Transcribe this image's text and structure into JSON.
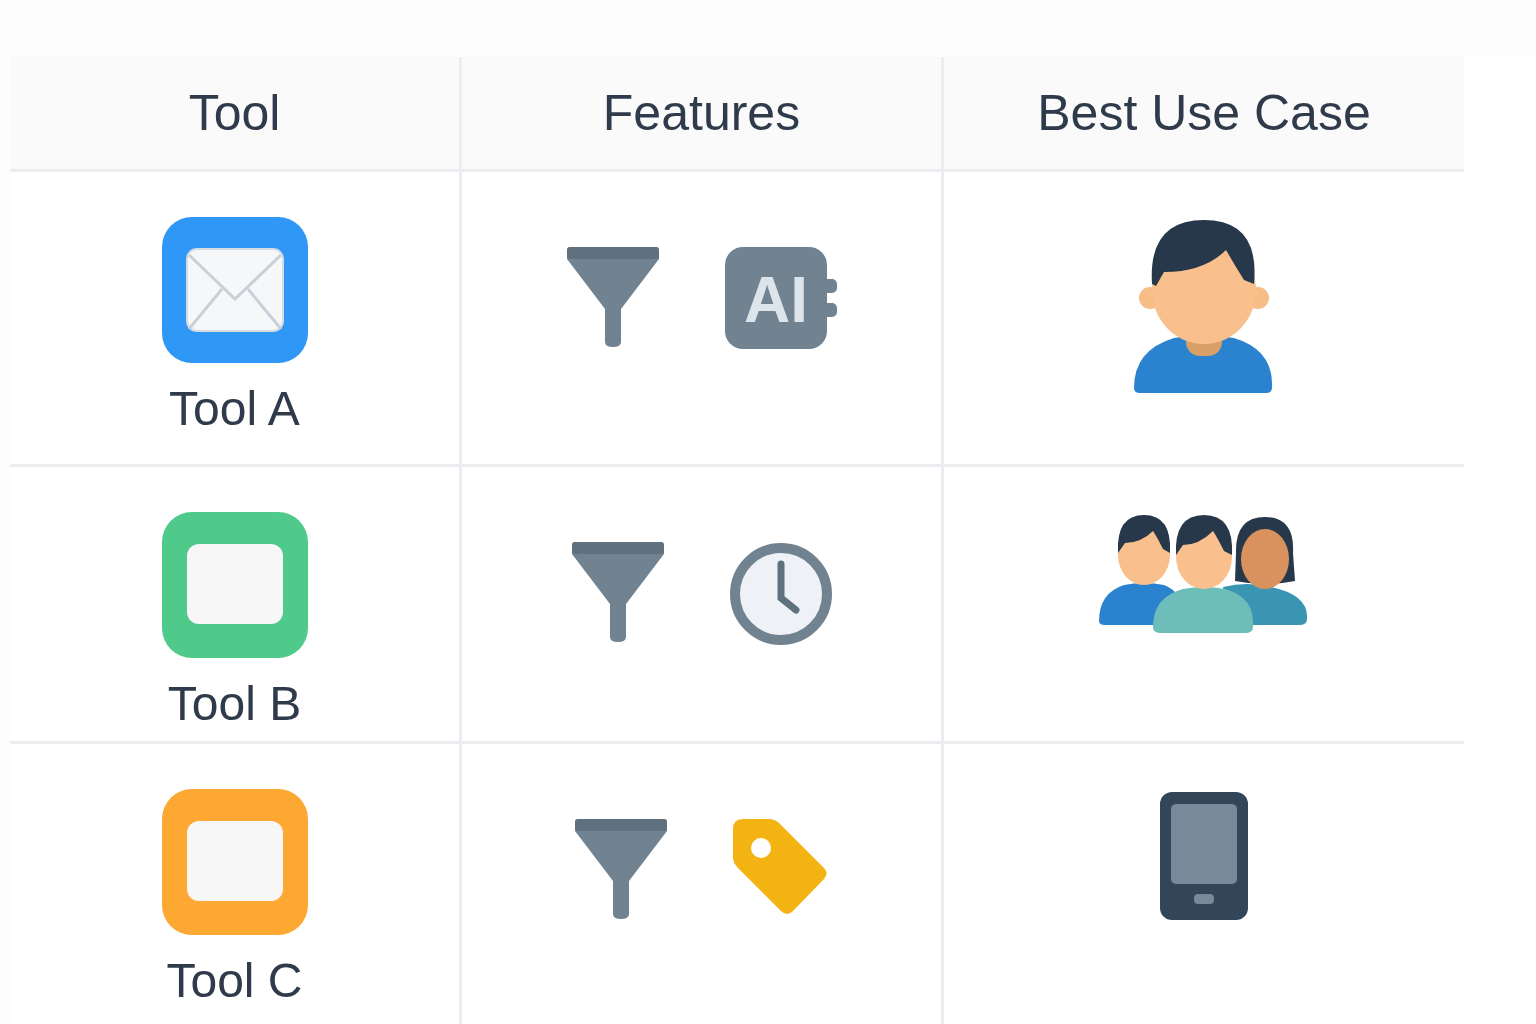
{
  "table": {
    "columns": [
      "Tool",
      "Features",
      "Best Use Case"
    ],
    "rows": [
      {
        "tool": {
          "label": "Tool A",
          "kind": "mail",
          "color": "#2f97f5"
        },
        "features": [
          {
            "kind": "filter"
          },
          {
            "kind": "ai",
            "text": "AI"
          }
        ],
        "use_case": {
          "kind": "person"
        }
      },
      {
        "tool": {
          "label": "Tool B",
          "kind": "blank",
          "color": "#4fca8a"
        },
        "features": [
          {
            "kind": "filter"
          },
          {
            "kind": "clock"
          }
        ],
        "use_case": {
          "kind": "group"
        }
      },
      {
        "tool": {
          "label": "Tool C",
          "kind": "blank",
          "color": "#fca833"
        },
        "features": [
          {
            "kind": "filter"
          },
          {
            "kind": "tag"
          }
        ],
        "use_case": {
          "kind": "phone"
        }
      }
    ]
  }
}
